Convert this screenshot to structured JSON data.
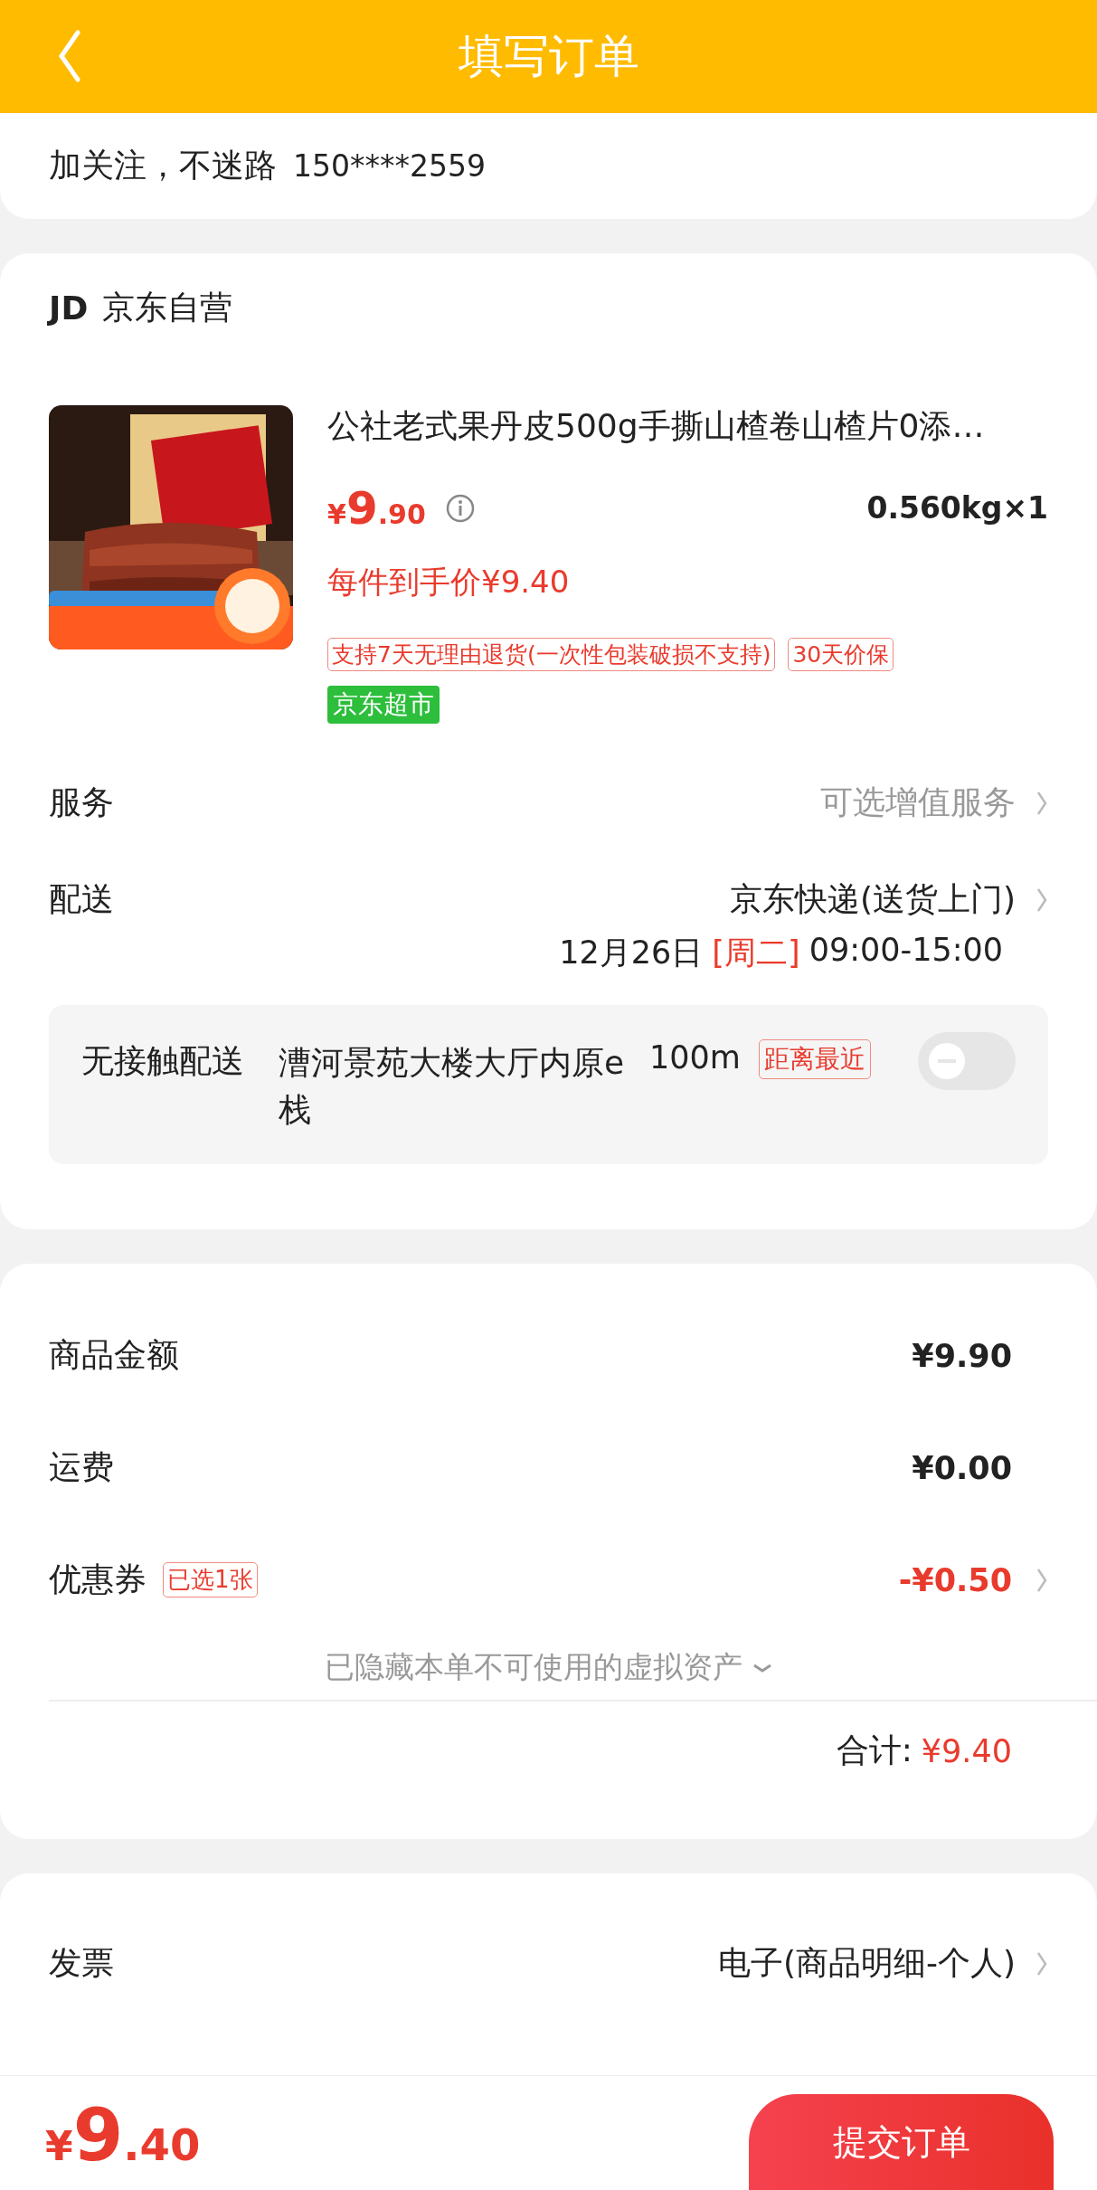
{
  "header": {
    "title": "填写订单"
  },
  "follow": {
    "text": "加关注，不迷路",
    "phone": "150****2559"
  },
  "store": {
    "logo": "JD",
    "name": "京东自营"
  },
  "product": {
    "kind": "picture",
    "title": "公社老式果丹皮500g手撕山楂卷山楂片0添…",
    "price": {
      "currency": "¥",
      "integer": "9",
      "decimal": ".90"
    },
    "weight": "0.560kg×1",
    "final_price": "每件到手价¥9.40",
    "tags": [
      {
        "text": "支持7天无理由退货(一次性包装破损不支持)",
        "kind": "outline"
      },
      {
        "text": "30天价保",
        "kind": "outline"
      }
    ],
    "badge": "京东超市"
  },
  "service": {
    "label": "服务",
    "value": "可选增值服务"
  },
  "delivery": {
    "label": "配送",
    "value": "京东快递(送货上门)",
    "date": "12月26日",
    "weekday": "[周二]",
    "time": "09:00-15:00"
  },
  "contactless": {
    "label": "无接触配送",
    "address": "漕河景苑大楼大厅内原e栈",
    "distance": "100m",
    "tag": "距离最近",
    "on": false
  },
  "amounts": [
    {
      "label": "商品金额",
      "value": "¥9.90",
      "kind": "plain",
      "chevron": false
    },
    {
      "label": "运费",
      "value": "¥0.00",
      "kind": "plain",
      "chevron": false
    },
    {
      "label": "优惠券",
      "tag": "已选1张",
      "value": "-¥0.50",
      "kind": "discount",
      "chevron": true
    }
  ],
  "hidden_assets": "已隐藏本单不可使用的虚拟资产",
  "total": {
    "label": "合计:",
    "value": "¥9.40"
  },
  "options": [
    {
      "label": "发票",
      "value": "电子(商品明细-个人)"
    }
  ],
  "bottom_bar": {
    "price": {
      "currency": "¥",
      "integer": "9",
      "decimal": ".40"
    },
    "submit": "提交订单"
  }
}
